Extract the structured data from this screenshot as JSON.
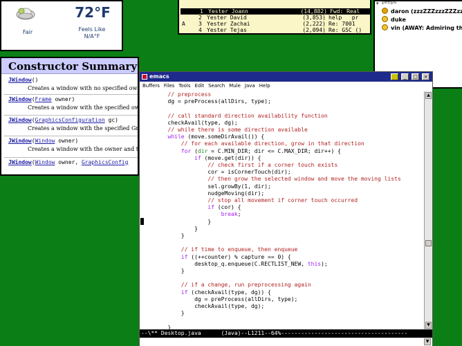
{
  "weather": {
    "temperature": "72°F",
    "condition": "Fair",
    "feels_like_label": "Feels Like",
    "feels_like_value": "N/A°F",
    "icon": "partly-cloudy-icon"
  },
  "mail": {
    "rows": [
      {
        "flag": "",
        "num": "1",
        "from": "Yester Joann",
        "size": "(14,882)",
        "subject": "Fwd: Real",
        "selected": true
      },
      {
        "flag": "",
        "num": "2",
        "from": "Yester David",
        "size": "(3,853)",
        "subject": "help   pr",
        "selected": false
      },
      {
        "flag": "A",
        "num": "3",
        "from": "Yester Zachai",
        "size": "(2,222)",
        "subject": "Re: 7001",
        "selected": false
      },
      {
        "flag": "",
        "num": "4",
        "from": "Yester Tejas",
        "size": "(2,094)",
        "subject": "Re: GSC ()",
        "selected": false
      }
    ]
  },
  "buddy": {
    "group": "peeps",
    "entries": [
      {
        "name": "daron (zzzZZZzzzZZZzzz",
        "status_color": "#e8a000"
      },
      {
        "name": "duke",
        "status_color": "#f2c12e"
      },
      {
        "name": "vin (AWAY: Admiring the",
        "status_color": "#f2c12e"
      }
    ]
  },
  "javadoc": {
    "title": "Constructor Summary",
    "entries": [
      {
        "ctor": "JWindow",
        "args_pre": "()",
        "args_link": "",
        "args_post": "",
        "desc": "Creates a window with no specified own"
      },
      {
        "ctor": "JWindow",
        "args_pre": "(",
        "args_link": "Frame",
        "args_post": " owner)",
        "desc": "Creates a window with the specified ow"
      },
      {
        "ctor": "JWindow",
        "args_pre": "(",
        "args_link": "GraphicsConfiguration",
        "args_post": " gc)",
        "desc": "Creates a window with the specified Gra"
      },
      {
        "ctor": "JWindow",
        "args_pre": "(",
        "args_link": "Window",
        "args_post": " owner)",
        "desc": "Creates a window with the owner and th"
      },
      {
        "ctor": "JWindow",
        "args_pre": "(",
        "args_link": "Window",
        "args_post": " owner, ",
        "args_link2": "GraphicsConfig",
        "desc": ""
      }
    ]
  },
  "emacs": {
    "title": "emacs",
    "menus": [
      "Buffers",
      "Files",
      "Tools",
      "Edit",
      "Search",
      "Mule",
      "Java",
      "Help"
    ],
    "modeline": "--\\** Desktop.java      (Java)--L1211--64%--------------------------------------",
    "code_lines": [
      [
        [
          "cm",
          "        // preprocess"
        ]
      ],
      [
        [
          "",
          "        dg = preProcess(allDirs, type);"
        ]
      ],
      [
        [
          "",
          ""
        ]
      ],
      [
        [
          "cm",
          "        // call standard direction availability function"
        ]
      ],
      [
        [
          "",
          "        checkAvail(type, dg);"
        ]
      ],
      [
        [
          "cm",
          "        // while there is some direction available"
        ]
      ],
      [
        [
          "kw",
          "        while"
        ],
        [
          "",
          " (move.someDirAvail()) {"
        ]
      ],
      [
        [
          "cm",
          "            // for each available direction, grow in that direction"
        ]
      ],
      [
        [
          "kw",
          "            for"
        ],
        [
          "",
          " ("
        ],
        [
          "ty",
          "dir"
        ],
        [
          "",
          " = C.MIN_DIR; dir <= C.MAX_DIR; dir++) {"
        ]
      ],
      [
        [
          "kw",
          "                if"
        ],
        [
          "",
          " (move.get(dir)) {"
        ]
      ],
      [
        [
          "cm",
          "                    // check first if a corner touch exists"
        ]
      ],
      [
        [
          "",
          "                    cor = isCornerTouch(dir);"
        ]
      ],
      [
        [
          "cm",
          "                    // then grow the selected window and move the moving lists"
        ]
      ],
      [
        [
          "",
          "                    sel.growBy(1, dir);"
        ]
      ],
      [
        [
          "",
          "                    nudgeMoving(dir);"
        ]
      ],
      [
        [
          "cm",
          "                    // stop all movement if corner touch occurred"
        ]
      ],
      [
        [
          "kw",
          "                    if"
        ],
        [
          "",
          " (cor) {"
        ]
      ],
      [
        [
          "kw",
          "                        break"
        ],
        [
          "",
          ";"
        ]
      ],
      [
        [
          "",
          "                    }"
        ]
      ],
      [
        [
          "",
          "                }"
        ]
      ],
      [
        [
          "",
          "            }"
        ]
      ],
      [
        [
          "",
          ""
        ]
      ],
      [
        [
          "cm",
          "            // if time to enqueue, then enqueue"
        ]
      ],
      [
        [
          "kw",
          "            if"
        ],
        [
          "",
          " ((++counter) % capture == 0) {"
        ]
      ],
      [
        [
          "",
          "                desktop_q.enqueue(C.RECTLIST_NEW, "
        ],
        [
          "kw",
          "this"
        ],
        [
          "",
          ");"
        ]
      ],
      [
        [
          "",
          "            }"
        ]
      ],
      [
        [
          "",
          ""
        ]
      ],
      [
        [
          "cm",
          "            // if a change, run preprocessing again"
        ]
      ],
      [
        [
          "kw",
          "            if"
        ],
        [
          "",
          " (checkAvail(type, dg)) {"
        ]
      ],
      [
        [
          "",
          "                dg = preProcess(allDirs, type);"
        ]
      ],
      [
        [
          "",
          "                checkAvail(type, dg);"
        ]
      ],
      [
        [
          "",
          "            }"
        ]
      ],
      [
        [
          "",
          ""
        ]
      ],
      [
        [
          "",
          "        }"
        ]
      ]
    ]
  }
}
